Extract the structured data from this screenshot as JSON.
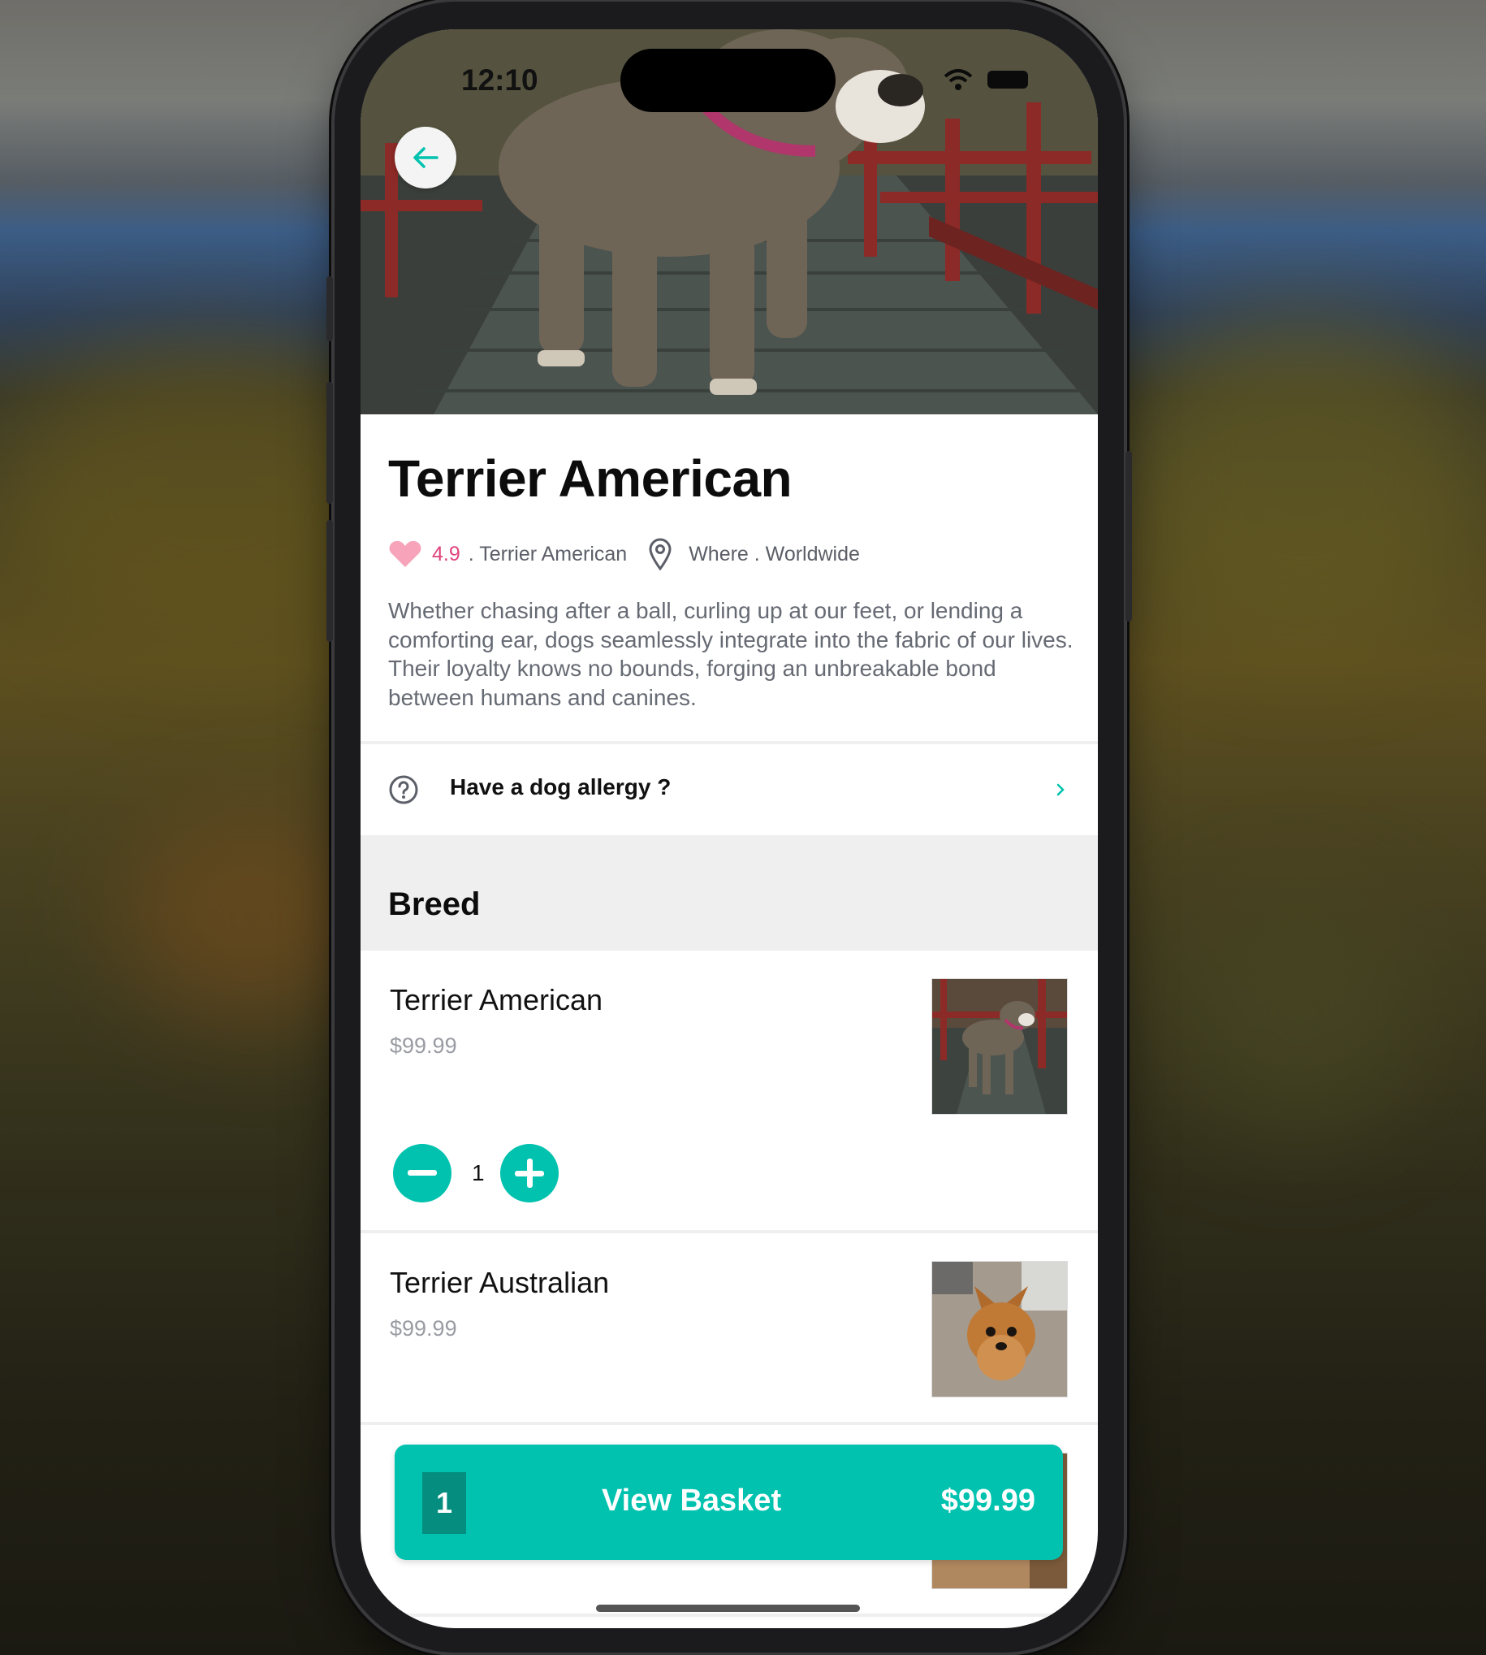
{
  "status_bar": {
    "time": "12:10"
  },
  "nav": {
    "back_icon": "arrow-left-icon"
  },
  "product": {
    "title": "Terrier American",
    "rating": "4.9",
    "breed_tag": ". Terrier American",
    "location": "Where . Worldwide",
    "description": "Whether chasing after a ball, curling up at our feet, or lending a comforting ear, dogs seamlessly integrate into the fabric of our lives. Their loyalty knows no bounds, forging an unbreakable bond between humans and canines."
  },
  "allergy": {
    "label": "Have a dog allergy ?",
    "icon": "question-circle-icon",
    "chevron": "chevron-right-icon"
  },
  "breed_section": {
    "title": "Breed",
    "items": [
      {
        "name": "Terrier American",
        "price": "$99.99",
        "quantity": "1"
      },
      {
        "name": "Terrier Australian",
        "price": "$99.99"
      }
    ]
  },
  "basket": {
    "count": "1",
    "label": "View Basket",
    "total": "$99.99"
  },
  "colors": {
    "accent": "#00c2ae",
    "accent_dark": "#058e80",
    "rating_pink": "#e0447c"
  }
}
